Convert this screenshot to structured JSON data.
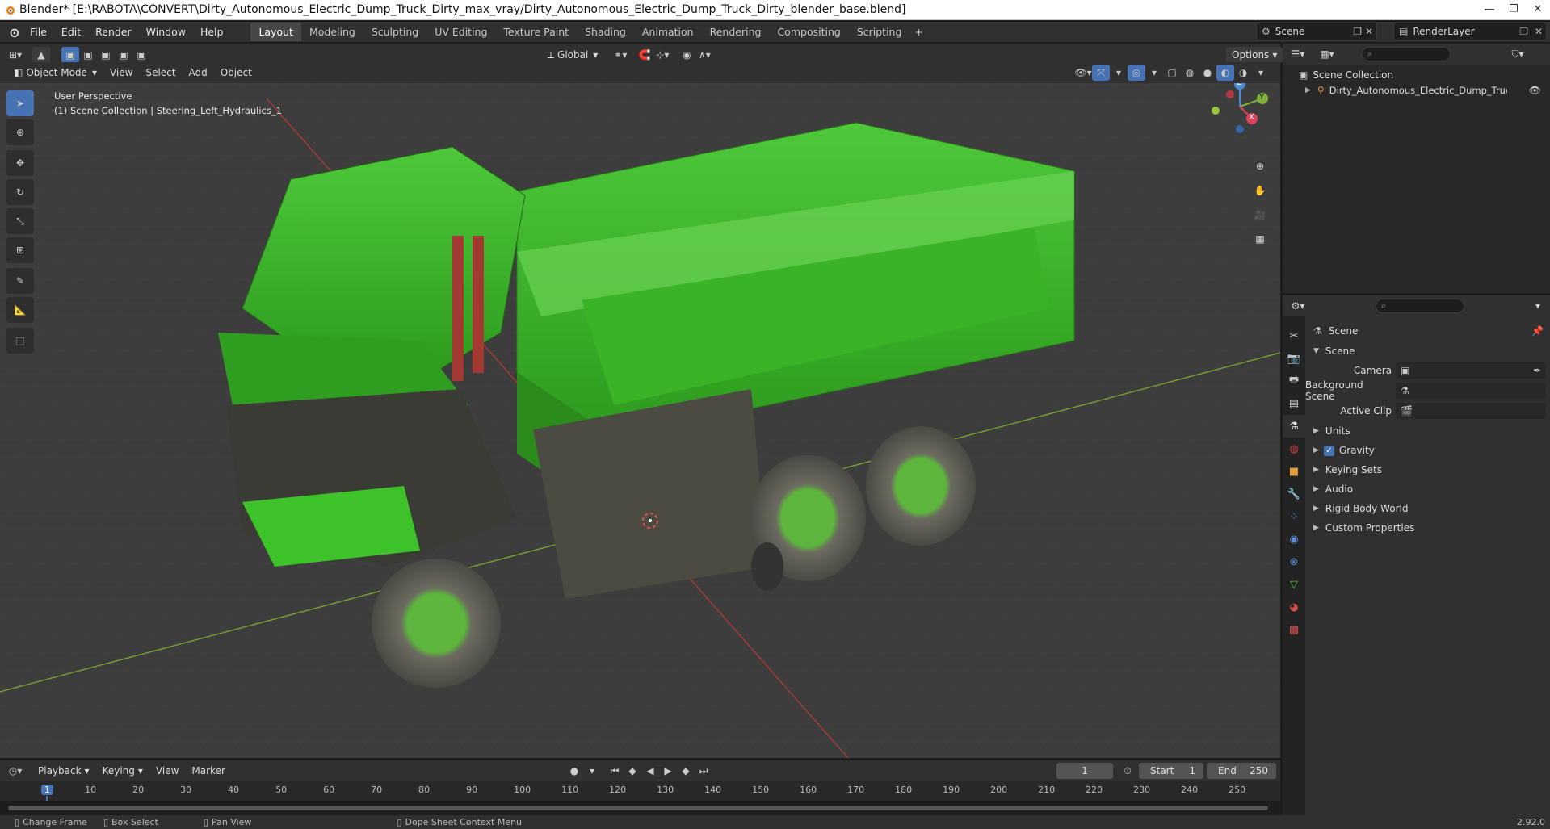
{
  "window": {
    "title": "Blender* [E:\\RABOTA\\CONVERT\\Dirty_Autonomous_Electric_Dump_Truck_Dirty_max_vray/Dirty_Autonomous_Electric_Dump_Truck_Dirty_blender_base.blend]"
  },
  "menu": [
    "File",
    "Edit",
    "Render",
    "Window",
    "Help"
  ],
  "workspaces": [
    "Layout",
    "Modeling",
    "Sculpting",
    "UV Editing",
    "Texture Paint",
    "Shading",
    "Animation",
    "Rendering",
    "Compositing",
    "Scripting"
  ],
  "workspace_active": "Layout",
  "scene_name": "Scene",
  "render_layer": "RenderLayer",
  "viewport_header": {
    "mode": "Object Mode",
    "menus": [
      "View",
      "Select",
      "Add",
      "Object"
    ],
    "transform": "Global",
    "options": "Options"
  },
  "viewport": {
    "perspective": "User Perspective",
    "collection_info": "(1) Scene Collection | Steering_Left_Hydraulics_1"
  },
  "gizmo": {
    "z": "Z",
    "y": "Y",
    "x": "X"
  },
  "outliner": {
    "root": "Scene Collection",
    "child": "Dirty_Autonomous_Electric_Dump_Truck_Di"
  },
  "properties": {
    "header": "Scene",
    "panel": "Scene",
    "camera_label": "Camera",
    "background_label": "Background Scene",
    "clip_label": "Active Clip",
    "sections": [
      "Units",
      "Gravity",
      "Keying Sets",
      "Audio",
      "Rigid Body World",
      "Custom Properties"
    ],
    "gravity_checked": true
  },
  "timeline": {
    "menus": [
      "Playback",
      "Keying",
      "View",
      "Marker"
    ],
    "current_frame": "1",
    "start_label": "Start",
    "start": "1",
    "end_label": "End",
    "end": "250",
    "ticks": [
      "1",
      "10",
      "20",
      "30",
      "40",
      "50",
      "60",
      "70",
      "80",
      "90",
      "100",
      "110",
      "120",
      "130",
      "140",
      "150",
      "160",
      "170",
      "180",
      "190",
      "200",
      "210",
      "220",
      "230",
      "240",
      "250"
    ]
  },
  "statusbar": {
    "items": [
      "Change Frame",
      "Box Select",
      "Pan View",
      "Dope Sheet Context Menu"
    ],
    "version": "2.92.0"
  },
  "colors": {
    "accent": "#4772b3",
    "truck": "#3ec22a",
    "bg": "#3d3d3d"
  }
}
